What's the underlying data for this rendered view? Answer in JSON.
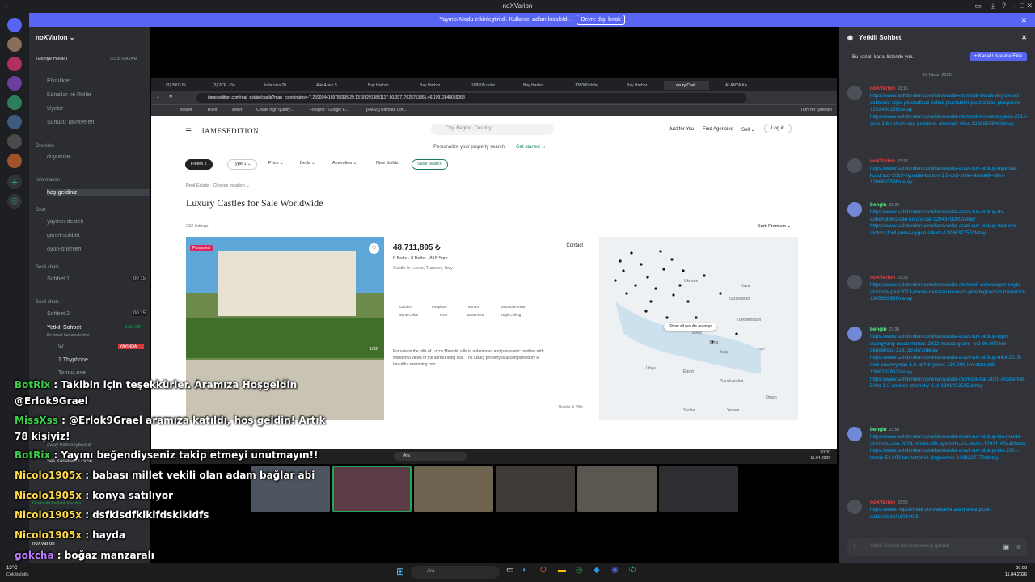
{
  "titlebar": {
    "title": "noXVarion"
  },
  "banner": {
    "text": "Yayıncı Modu etkinleştirildi. Kullanıcı adları kısaltıldı.",
    "button": "Devre dışı bırak"
  },
  "server": {
    "name": "noXVarion",
    "boost_label": "Takviye Hedefi",
    "boost_count": "0/33 Takviye"
  },
  "channels": {
    "top": [
      "Etkinlikler",
      "Kanallar ve Roller",
      "Üyeler",
      "Sunucu Takviyeleri"
    ],
    "cat_onerilen": "Önerilen",
    "ch_duyurular": "duyurular",
    "cat_information": "Information",
    "ch_hos": "hoş-geldiniz",
    "cat_chat": "Chat",
    "chat_list": [
      "yayıncı-destek",
      "genel-sohbet",
      "oyun-önerileri"
    ],
    "cat_voice1": "Sesli chats",
    "voice1": "Sohbet 1",
    "voice1_count": "00 15",
    "cat_voice2": "Sesli chats",
    "voice2": "Sohbet 2",
    "voice2_count": "00 15",
    "yetkili": "Yetkili Sohbet",
    "yetkili_time": "2:31:09",
    "yetkili_sub": "Bir kanal durumu belirle",
    "member1": "W...",
    "member1_badge": "YAYINDA",
    "member2": "1 Thyphone",
    "member3": "Tomuz.exe",
    "away": "away from keyboard",
    "voice_conn": "Ses Kanallarını Gizle",
    "video_conn": "Görüntülü Bağlantı Kuruldu"
  },
  "browser": {
    "tabs": [
      "(3) 2003 Ni...",
      "(3) 2CR - Se...",
      "lada niva 20...",
      "Aile Aracı S...",
      "Bay Harbor...",
      "Bay Harbor...",
      "288500 dolar...",
      "Bay Harbor...",
      "138000 dolar...",
      "Bay Harbor...",
      "Luxury Cast...",
      "ALANYA KA..."
    ],
    "url": "jamesedition.com/real_estate/castle?map_coordinates=-7.2590944169789395,29.131692913831117,60.09717625753365,46.19912848059068",
    "bookmarks": [
      "siyafet",
      "Bıcot",
      "anket",
      "Create high quality...",
      "Fotoğraf - Google F...",
      "[FMSS] Ultimate Diff..."
    ],
    "bookmarks_right": "Tüm Yer İşaretleri"
  },
  "site": {
    "logo": "JAMESEDITION",
    "search_placeholder": "City, Region, Country",
    "nav": [
      "Just for You",
      "Find Agencies",
      "Sell ⌄"
    ],
    "login": "Log in",
    "personalize": "Personalize your property search",
    "get_started": "Get started →",
    "filters": [
      "Filters 2",
      "Type 1 ⌄",
      "Price ⌄",
      "Beds ⌄",
      "Amenities ⌄",
      "New Builds",
      "Save search"
    ],
    "breadcrumb": "Real Estate · Choose location ⌄",
    "heading": "Luxury Castles for Sale Worldwide",
    "listings": "232 listings",
    "sort": "Sort: Premium ⌄",
    "card_promoted": "Promoted",
    "card_photo_count": "1/32",
    "price": "48,711,895 ₺",
    "contact": "Contact",
    "specs": "6 Beds · 8 Baths · 818 Sqm",
    "location": "Castle in Lucca, Tuscany, Italy",
    "amenities": [
      "Garden",
      "Fireplace",
      "Terrace",
      "Mountain View",
      "Wine Cellar",
      "Pool",
      "Basement",
      "High Ceiling"
    ],
    "description": "For sale in the hills of Lucca Majestic villa in a dominant and panoramic position with wonderful views of the surrounding hills. The luxury property is accompanied by a beautiful swimming poo...",
    "agency": "Rustici & Ville",
    "map_button": "Show all results on map",
    "map_labels": [
      "Ukraine",
      "Kazakhstan",
      "Turkmenistan",
      "Turkey",
      "Syria",
      "Iraq",
      "Iran",
      "Egypt",
      "Libya",
      "Saudi Arabia",
      "Sudan",
      "Yemen",
      "Oman",
      "Kaza"
    ]
  },
  "inner_taskbar": {
    "search": "Ara",
    "time": "00:00",
    "date": "11.04.2026"
  },
  "chatpanel": {
    "title": "Yetkili Sohbet",
    "no_list": "Bu kanal, kanal listende yok.",
    "add_btn": "+ Kanal Listesine Ekle",
    "date_divider": "10 Nisan 2026",
    "messages": [
      {
        "user": "noXVarion",
        "color": "#f23f42",
        "time": "23:16",
        "links": [
          "https://www.sahibinden.com/ilan/vasita-otomobil-skoda-degisensiz-coktemiz-style-plushafizali-koltuk-plustabilet-plushafizali-plusperde-1292499136/detay",
          "https://www.sahibinden.com/ilan/vasita-otomobil-honda-boyasiz-2015-civic-1.6-i-vtech-eco-premium-otomatik-vites-1298250840/detay"
        ]
      },
      {
        "user": "noXVarion",
        "color": "#f23f42",
        "time": "23:32",
        "links": [
          "https://www.sahibinden.com/ilan/vasita-arazi-suv-pickup-hyundai-kusursuz-2019-hyundai-tucson-1.6-crdi-style-otomatik-vites-1266683586/detay"
        ]
      },
      {
        "user": "bengin",
        "color": "#57f287",
        "time": "23:32",
        "links": [
          "https://www.sahibinden.com/ilan/vasita-arazi-suv-pickup-ds-automobiles-can-luxury-car-1294379200/detay",
          "https://www.sahibinden.com/ilan/vasita-arazi-suv-pickup-ford-eyc-motors-ford-puma-uygun-rakam-1308632757/detay"
        ]
      },
      {
        "user": "noXVarion",
        "color": "#f23f42",
        "time": "23:38",
        "links": [
          "https://www.sahibinden.com/ilan/vasita-otomobil-volkswagen-soylu-otomotiv-plus2013-model-cam-tavan-ve-cc-plusdegisensiz-tramersiz-1305869668/detay"
        ]
      },
      {
        "user": "bengin",
        "color": "#57f287",
        "time": "23:38",
        "links": [
          "https://www.sahibinden.com/ilan/vasita-arazi-suv-pickup-kgm-ssangyong-rocco-motors-2022-musso-grand-4x2-86.000-km-degisensiz-1297337872/detay",
          "https://www.sahibinden.com/ilan/vasita-arazi-suv-pickup-mini-2015-mini-countryman-1.6-all4-tr-paket-134.000-km-otomatik-1308782892/detay",
          "https://www.sahibinden.com/ilan/vasita-otomobil-fiat-2020-model-fiat-500c-1.2-senturk-otomotiv-2.el-1301432535/detay"
        ]
      },
      {
        "user": "bengin",
        "color": "#57f287",
        "time": "23:50",
        "links": [
          "https://www.sahibinden.com/ilan/vasita-arazi-suv-pickup-kia-marde-otomotiv-den-2024-model-sifir-ayarinda-kia-stonic-1292116244/detay",
          "https://www.sahibinden.com/ilan/vasita-arazi-suv-pickup-kia-2021-stonic-54.000-km-tertemiz-degisensiz-1308327770/detay"
        ]
      },
      {
        "user": "noXVarion",
        "color": "#f23f42",
        "time": "23:55",
        "links": [
          "https://www.hepsiemlak.com/antalya-alanya-kargicak-satilik/daire/160190-5"
        ]
      }
    ],
    "input_placeholder": "Yetkili Sohbet kanalına mesaj gönder"
  },
  "overlay": [
    {
      "user": "BotRix",
      "color": "#3fcf4b",
      "text": " : Takibin için teşekkürler. Aramıza Hoşgeldin @Erlok9Grael"
    },
    {
      "user": "MissXss",
      "color": "#3fcf4b",
      "text": " : @Erlok9Grael aramıza katıldı, hoş geldin! Artık 78 kişiyiz!"
    },
    {
      "user": "BotRix",
      "color": "#3fcf4b",
      "text": " : Yayını beğendiyseniz takip etmeyi unutmayın!!"
    },
    {
      "user": "Nicolo1905x",
      "color": "#ffd94a",
      "text": " : babası millet vekili olan adam bağlar abi"
    },
    {
      "user": "Nicolo1905x",
      "color": "#ffd94a",
      "text": " : konya satılıyor"
    },
    {
      "user": "Nicolo1905x",
      "color": "#ffd94a",
      "text": " : dsfklsdfklklfdsklkldfs"
    },
    {
      "user": "Nicolo1905x",
      "color": "#ffd94a",
      "text": " : hayda"
    },
    {
      "user": "gokcha",
      "color": "#c07cff",
      "text": " : boğaz manzaralı"
    }
  ],
  "footer_user": "noXVarion",
  "wintaskbar": {
    "weather_temp": "13°C",
    "weather_desc": "Çok bulutlu",
    "search": "Ara",
    "time": "00:00",
    "date": "11.04.2026"
  }
}
